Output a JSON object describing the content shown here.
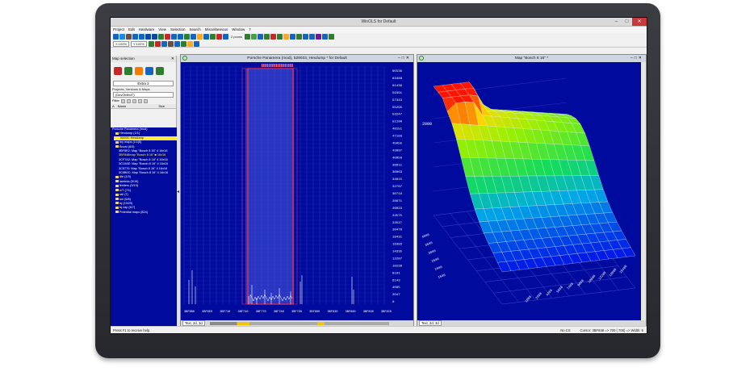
{
  "app": {
    "title": "WinOLS for Default"
  },
  "window_controls": {
    "minimize": "–",
    "maximize": "□",
    "close": "✕"
  },
  "menu": [
    "Project",
    "Edit",
    "Hardware",
    "View",
    "Selection",
    "Search",
    "Miscellaneous",
    "Window",
    "?"
  ],
  "toolbar": {
    "row1_icon_colors": [
      "#1565c0",
      "#1e88e5",
      "#6d4c41",
      "#1565c0",
      "#1565c0",
      "#0d47a1",
      "#0d47a1",
      "#2e7d32",
      "#c62828",
      "#1565c0",
      "#1565c0",
      "#2e7d32",
      "#1565c0",
      "#f9a825",
      "#1565c0",
      "#2e7d32",
      "#c62828",
      "#1565c0"
    ],
    "element_size": "2 prows",
    "row1_icon_colors_b": [
      "#2e7d32",
      "#43a047",
      "#1565c0",
      "#2e7d32",
      "#c62828",
      "#2e7d32",
      "#f9a825",
      "#1565c0",
      "#2e7d32",
      "#1565c0",
      "#1565c0",
      "#6a1b9a",
      "#1565c0",
      "#2e7d32"
    ],
    "zoom_x": "X:100%",
    "zoom_y": "Y:100%",
    "row2_icon_colors": [
      "#2e7d32",
      "#c62828",
      "#1565c0",
      "#6d4c41",
      "#1565c0",
      "#2e7d32",
      "#f9a825",
      "#1565c0"
    ]
  },
  "map_selection": {
    "title": "Map selection",
    "icon_colors": [
      "#c62828",
      "#2e7d32",
      "#f57c00",
      "#1565c0",
      "#2e7d32"
    ],
    "extra_label": "Extra 2",
    "projects_label": "Projects, Versions & Maps",
    "project_select": "(DevOldHdT)",
    "filter_label": "Filter",
    "columns": [
      "A",
      "Name",
      "Size"
    ],
    "tree": [
      {
        "label": "Porsche Panamera (mod)",
        "level": 0,
        "kind": "root"
      },
      {
        "label": "Hexdump (1/1)",
        "level": 1,
        "kind": "folder"
      },
      {
        "label": "00000: Hexdump",
        "level": 2,
        "kind": "selected"
      },
      {
        "label": "my maps (1/1|5)",
        "level": 1,
        "kind": "folder"
      },
      {
        "label": "Boost (6/5)",
        "level": 1,
        "kind": "folder"
      },
      {
        "label": "3BF5E2: Map \"Bosch 8 16\"  4 16x16",
        "level": 2,
        "kind": "item"
      },
      {
        "label": "3BF848map \"Bosch 8 16\"  ■ 16x16",
        "level": 2,
        "kind": "highlight"
      },
      {
        "label": "3CF7A2: Map \"Bosch 8 16\"  4 16x16",
        "level": 2,
        "kind": "item"
      },
      {
        "label": "3C10AE: Map \"Bosch 8 16\"  4 16x16",
        "level": 2,
        "kind": "item"
      },
      {
        "label": "3C5770: Map \"Bosch 8 16\"  4 16x16",
        "level": 2,
        "kind": "item"
      },
      {
        "label": "3C6B0C: Map \"Bosch 8 16\"  4 16x16",
        "level": 2,
        "kind": "item"
      },
      {
        "label": "die (1/3)",
        "level": 1,
        "kind": "folder"
      },
      {
        "label": "lambda (9/19)",
        "level": 1,
        "kind": "folder"
      },
      {
        "label": "limiters (9/19)",
        "level": 1,
        "kind": "folder"
      },
      {
        "label": "n/T (7/1)",
        "level": 1,
        "kind": "folder"
      },
      {
        "label": "rail (7)",
        "level": 1,
        "kind": "folder"
      },
      {
        "label": "sm (6/8)",
        "level": 1,
        "kind": "folder"
      },
      {
        "label": "tq (19/29)",
        "level": 1,
        "kind": "folder"
      },
      {
        "label": "tq cap (6/7)",
        "level": 1,
        "kind": "folder"
      },
      {
        "label": "Potential maps (824)",
        "level": 1,
        "kind": "folder"
      }
    ]
  },
  "hex_window": {
    "title": "Porsche Panamera (mod), 529033, Hexdump * for Default",
    "y_ticks": [
      "65536",
      "61439",
      "57343",
      "53247",
      "49151",
      "45055",
      "40959",
      "36863",
      "32767",
      "28671",
      "24575",
      "20479",
      "16383",
      "12287",
      "8191",
      "4095",
      "0"
    ],
    "y_ticks_alt": [
      "63488",
      "59391",
      "55295",
      "51199",
      "47103",
      "43007",
      "38911",
      "34815",
      "30719",
      "26623",
      "22527",
      "18431",
      "14335",
      "10239",
      "6143",
      "2047"
    ],
    "x_ticks": [
      "3BF6B0",
      "3BF6E0",
      "3BF710",
      "3BF740",
      "3BF770",
      "3BF7A0",
      "3BF7D0",
      "3BF800",
      "3BF830",
      "3BF860",
      "3BF890",
      "3BF8C0"
    ],
    "tab_label": "Text, 2d, 3d"
  },
  "map_window": {
    "title": "Map \"Bosch 8 16\" *",
    "z_tick": "2000",
    "axis_left": [
      "4000",
      "3500",
      "3000",
      "2500",
      "2000",
      "1500"
    ],
    "axis_right": [
      "15488",
      "13888",
      "12288",
      "10688",
      "9088",
      "7488",
      "5888",
      "4288",
      "2688",
      "1088"
    ],
    "tab_label": "Text, 2d, 3d"
  },
  "status": {
    "help": "Press F1 to receive help.",
    "checksum": "No CS",
    "cursor": "Cursor: 3BF848 => 700 ( 700) => Width: 6"
  }
}
